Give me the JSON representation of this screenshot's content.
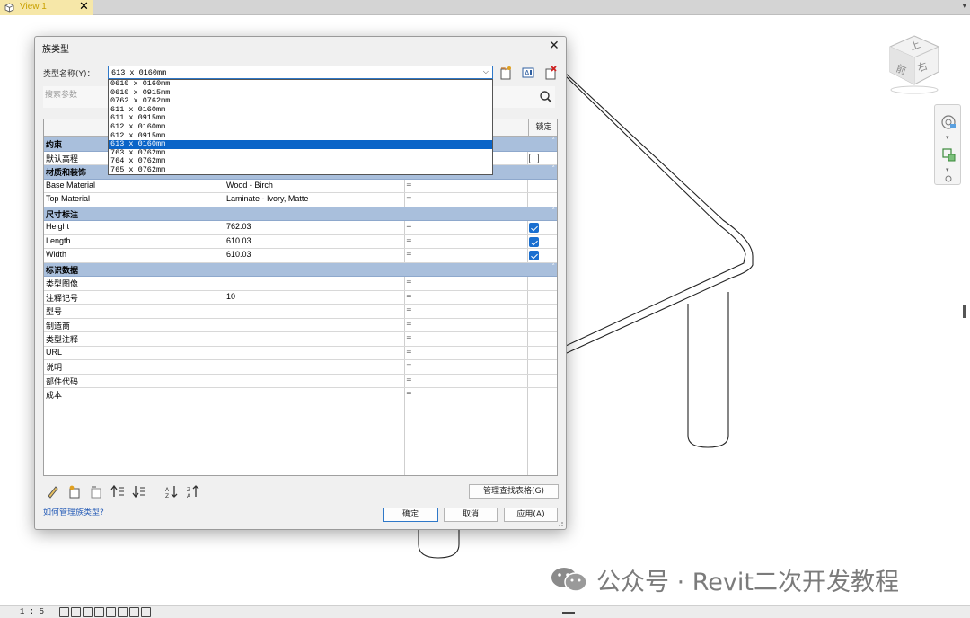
{
  "tab": {
    "title": "View 1",
    "close_glyph": "✕",
    "menu_glyph": "▾"
  },
  "dialog": {
    "title": "族类型",
    "close_glyph": "✕",
    "type_label": "类型名称(Y)：",
    "type_value": "613 x 0160mm",
    "search_placeholder": "搜索参数",
    "type_options": [
      "0610 x 0160mm",
      "0610 x 0915mm",
      "0762 x 0762mm",
      "611 x 0160mm",
      "611 x 0915mm",
      "612 x 0160mm",
      "612 x 0915mm",
      "613 x 0160mm",
      "763 x 0762mm",
      "764 x 0762mm",
      "765 x 0762mm"
    ],
    "selected_option": "613 x 0160mm",
    "table": {
      "lock_header": "锁定",
      "rows": [
        {
          "kind": "group",
          "name": "约束"
        },
        {
          "kind": "param",
          "name": "默认高程",
          "value": "",
          "formula": "",
          "lock": false
        },
        {
          "kind": "group",
          "name": "材质和装饰"
        },
        {
          "kind": "param",
          "name": "Base Material",
          "value": "Wood - Birch",
          "formula": "=",
          "lock": null
        },
        {
          "kind": "param",
          "name": "Top Material",
          "value": "Laminate - Ivory, Matte",
          "formula": "=",
          "lock": null
        },
        {
          "kind": "group",
          "name": "尺寸标注"
        },
        {
          "kind": "param",
          "name": "Height",
          "value": "762.03",
          "formula": "=",
          "lock": true
        },
        {
          "kind": "param",
          "name": "Length",
          "value": "610.03",
          "formula": "=",
          "lock": true
        },
        {
          "kind": "param",
          "name": "Width",
          "value": "610.03",
          "formula": "=",
          "lock": true
        },
        {
          "kind": "group",
          "name": "标识数据"
        },
        {
          "kind": "param",
          "name": "类型图像",
          "value": "",
          "formula": "=",
          "lock": null
        },
        {
          "kind": "param",
          "name": "注释记号",
          "value": "10",
          "formula": "=",
          "lock": null
        },
        {
          "kind": "param",
          "name": "型号",
          "value": "",
          "formula": "=",
          "lock": null
        },
        {
          "kind": "param",
          "name": "制造商",
          "value": "",
          "formula": "=",
          "lock": null
        },
        {
          "kind": "param",
          "name": "类型注释",
          "value": "",
          "formula": "=",
          "lock": null
        },
        {
          "kind": "param",
          "name": "URL",
          "value": "",
          "formula": "=",
          "lock": null
        },
        {
          "kind": "param",
          "name": "说明",
          "value": "",
          "formula": "=",
          "lock": null
        },
        {
          "kind": "param",
          "name": "部件代码",
          "value": "",
          "formula": "=",
          "lock": null
        },
        {
          "kind": "param",
          "name": "成本",
          "value": "",
          "formula": "=",
          "lock": null
        }
      ]
    },
    "manage_lookup_label": "管理查找表格(G)",
    "help_link": "如何管理族类型?",
    "ok_label": "确定",
    "cancel_label": "取消",
    "apply_label": "应用(A)",
    "group_caret": "˄"
  },
  "viewcube": {
    "top_label": "上",
    "front_label": "前",
    "right_label": "右"
  },
  "statusbar": {
    "scale": "1 : 5"
  },
  "watermark": {
    "text": "公众号 · Revit二次开发教程"
  },
  "colors": {
    "accent": "#0a64c8",
    "group_row": "#a9bfdc",
    "tab": "#f6e7a8"
  }
}
